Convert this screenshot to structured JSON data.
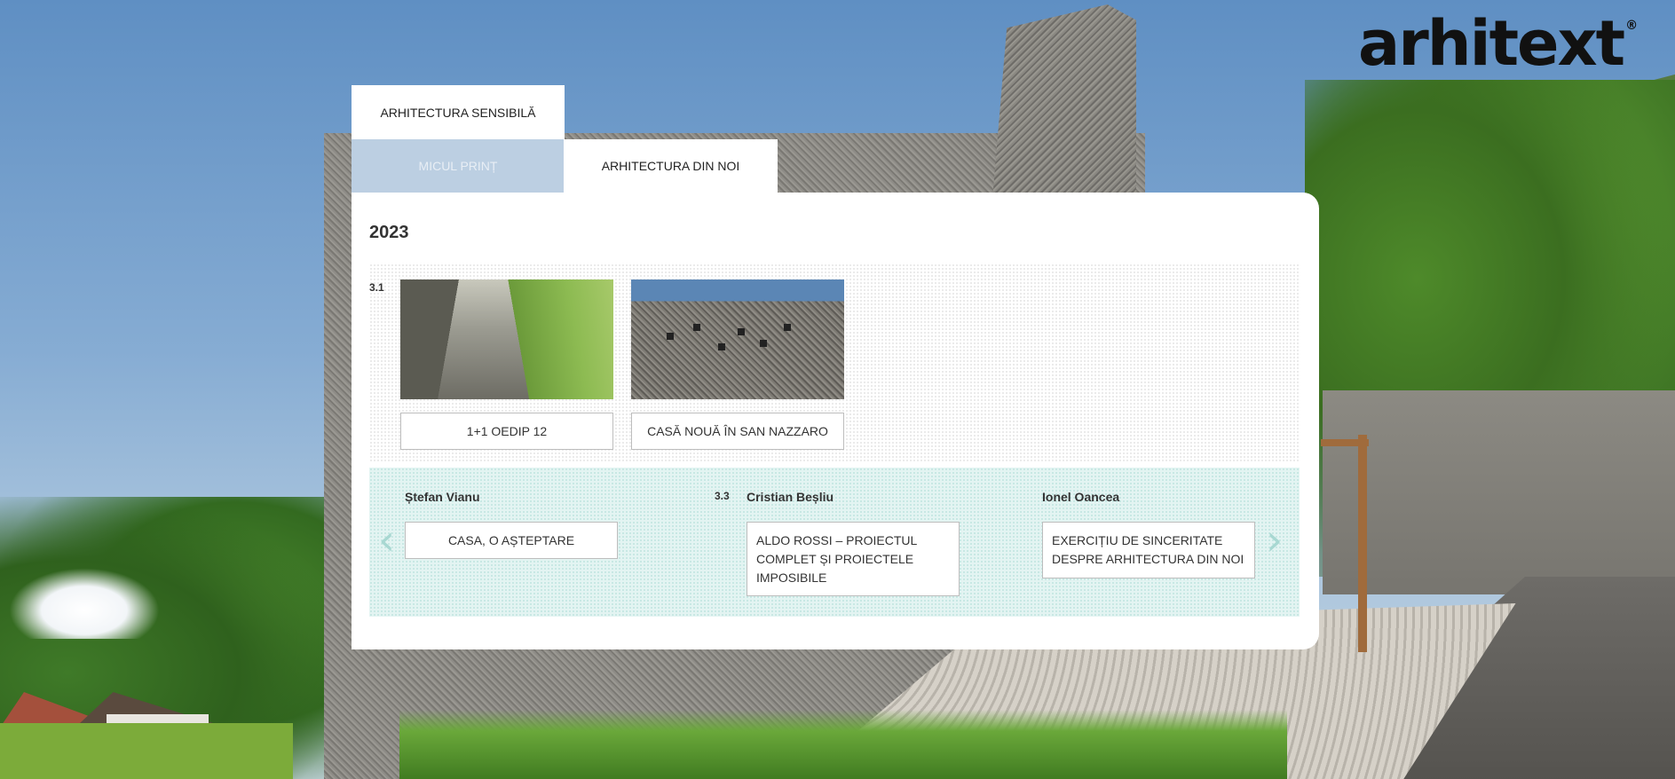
{
  "logo": {
    "text": "arhitext",
    "mark": "®"
  },
  "tabs": [
    {
      "label": "ARHITECTURA SENSIBILĂ"
    },
    {
      "label": "MICUL PRINȚ"
    },
    {
      "label": "ARHITECTURA DIN NOI"
    }
  ],
  "panel": {
    "year": "2023",
    "issue_first": "3.1",
    "articles": [
      {
        "title": "1+1 OEDIP 12"
      },
      {
        "title": "CASĂ NOUĂ ÎN SAN NAZZARO"
      }
    ],
    "carousel": {
      "issue": "3.3",
      "items": [
        {
          "author": "Ștefan Vianu",
          "title": "CASA, O AȘTEPTARE"
        },
        {
          "author": "Cristian Beșliu",
          "title": "ALDO ROSSI – PROIECTUL COMPLET ȘI PROIECTELE IMPOSIBILE"
        },
        {
          "author": "Ionel Oancea",
          "title": "EXERCIȚIU DE SINCERITATE DESPRE ARHITECTURA DIN NOI"
        }
      ],
      "prev_icon": "chevron-left-icon",
      "next_icon": "chevron-right-icon"
    }
  }
}
